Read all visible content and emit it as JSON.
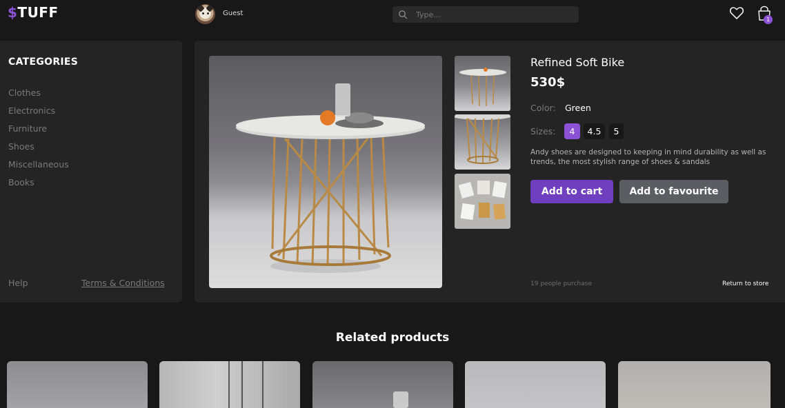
{
  "header": {
    "logo_symbol": "$",
    "logo_text": "TUFF",
    "user_name": "Guest",
    "search_placeholder": "Type...",
    "cart_count": "1"
  },
  "sidebar": {
    "title": "CATEGORIES",
    "categories": [
      "Clothes",
      "Electronics",
      "Furniture",
      "Shoes",
      "Miscellaneous",
      "Books"
    ],
    "help": "Help",
    "terms": "Terms & Conditions"
  },
  "product": {
    "name": "Refined Soft Bike",
    "price": "530$",
    "color_label": "Color:",
    "color_value": "Green",
    "sizes_label": "Sizes:",
    "sizes": [
      "4",
      "4.5",
      "5"
    ],
    "selected_size": "4",
    "description": "Andy shoes are designed to keeping in mind durability as well as trends, the most stylish range of shoes & sandals",
    "add_to_cart": "Add to cart",
    "add_to_favourite": "Add to favourite",
    "purchases": "19 people purchase",
    "return_link": "Return to store"
  },
  "related": {
    "title": "Related products"
  },
  "colors": {
    "accent": "#8c52d6",
    "background": "#181818",
    "panel": "#242424",
    "muted_text": "#7a7a7a"
  }
}
